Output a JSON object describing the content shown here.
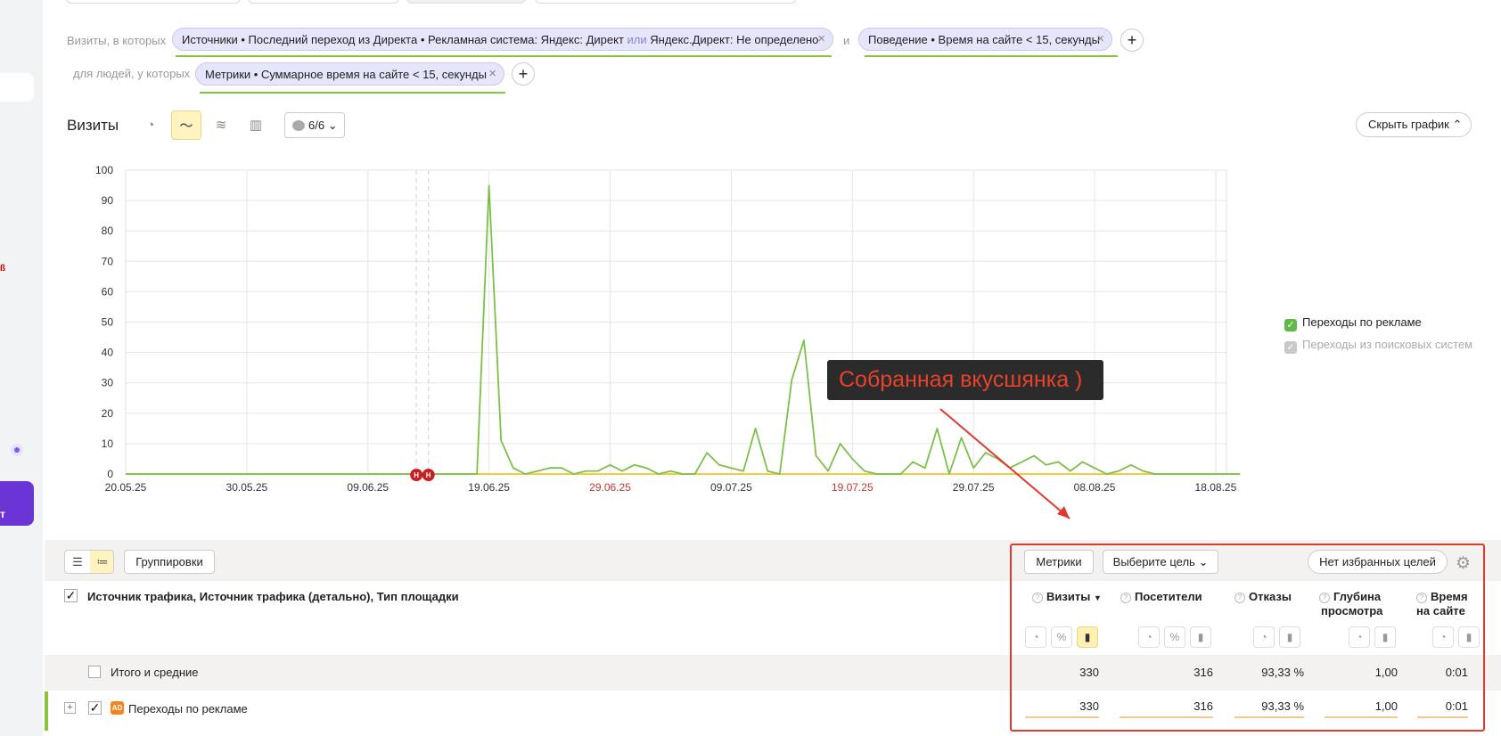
{
  "segment": {
    "visits_label": "Визиты, в которых",
    "chip1_text": "Источники • Последний переход из Директа • Рекламная система: Яндекс: Директ",
    "chip1_or": "или",
    "chip1_tail": "Яндекс.Директ: Не определено",
    "and_label": "и",
    "chip2_text": "Поведение • Время на сайте < 15, секунды",
    "people_label": "для людей, у которых",
    "chip3_text": "Метрики • Суммарное время на сайте < 15, секунды",
    "remove_glyph": "×",
    "add_glyph": "+"
  },
  "chart_header": {
    "title": "Визиты",
    "annotations_count": "6/6",
    "hide_chart_label": "Скрыть график"
  },
  "chart_data": {
    "type": "line",
    "ylim": [
      0,
      100
    ],
    "yticks": [
      "100",
      "90",
      "80",
      "70",
      "60",
      "50",
      "40",
      "30",
      "20",
      "10",
      "0"
    ],
    "x_start": "2025-05-20",
    "xticks": [
      {
        "label": "20.05.25",
        "weekend": false
      },
      {
        "label": "30.05.25",
        "weekend": false
      },
      {
        "label": "09.06.25",
        "weekend": false
      },
      {
        "label": "19.06.25",
        "weekend": false
      },
      {
        "label": "29.06.25",
        "weekend": true
      },
      {
        "label": "09.07.25",
        "weekend": false
      },
      {
        "label": "19.07.25",
        "weekend": true
      },
      {
        "label": "29.07.25",
        "weekend": false
      },
      {
        "label": "08.08.25",
        "weekend": false
      },
      {
        "label": "18.08.25",
        "weekend": false
      }
    ],
    "series": [
      {
        "name": "Переходы по рекламе",
        "color": "#7cc04b",
        "values": [
          0,
          0,
          0,
          0,
          0,
          0,
          0,
          0,
          0,
          0,
          0,
          0,
          0,
          0,
          0,
          0,
          0,
          0,
          0,
          0,
          0,
          0,
          0,
          0,
          0,
          0,
          0,
          0,
          0,
          0,
          95,
          11,
          2,
          0,
          1,
          2,
          2,
          0,
          1,
          1,
          3,
          1,
          3,
          2,
          0,
          1,
          0,
          0,
          7,
          3,
          2,
          1,
          15,
          1,
          0,
          31,
          44,
          6,
          1,
          10,
          5,
          1,
          0,
          0,
          0,
          4,
          2,
          15,
          0,
          12,
          2,
          7,
          5,
          2,
          4,
          6,
          3,
          4,
          1,
          4,
          2,
          0,
          1,
          3,
          1,
          0,
          0,
          0,
          0,
          0,
          0,
          0,
          0
        ]
      },
      {
        "name": "Переходы из поисковых систем",
        "color": "#f2cc3a",
        "values": [
          0,
          0,
          0,
          0,
          0,
          0,
          0,
          0,
          0,
          0,
          0,
          0,
          0,
          0,
          0,
          0,
          0,
          0,
          0,
          0,
          0,
          0,
          0,
          0,
          0,
          0,
          0,
          0,
          0,
          0,
          0,
          0,
          0,
          0,
          0,
          0,
          0,
          0,
          0,
          0,
          0,
          0,
          0,
          0,
          0,
          0,
          0,
          0,
          0,
          0,
          0,
          0,
          0,
          0,
          0,
          0,
          0,
          0,
          0,
          0,
          0,
          0,
          0,
          0,
          0,
          0,
          0,
          0,
          0,
          0,
          0,
          0,
          0,
          0,
          0,
          0,
          0,
          0,
          0,
          0,
          0,
          0,
          0,
          0,
          0,
          0,
          0,
          0,
          0,
          0,
          0,
          0,
          0
        ]
      }
    ],
    "markers": [
      {
        "label": "Н",
        "x": "2025-06-13"
      },
      {
        "label": "Н",
        "x": "2025-06-14"
      }
    ],
    "grid": true
  },
  "legend": [
    {
      "label": "Переходы по рекламе",
      "checked": true,
      "color": "#5fb84a"
    },
    {
      "label": "Переходы из поисковых систем",
      "checked": true,
      "color": "#c8c8c8"
    }
  ],
  "callout": "Собранная вкусшянка )",
  "toolbar": {
    "groupings_label": "Группировки",
    "metrics_label": "Метрики",
    "goal_label": "Выберите цель",
    "fav_goals_label": "Нет избранных целей"
  },
  "table": {
    "dimension_title": "Источник трафика, Источник трафика (детально), Тип площадки",
    "columns": [
      {
        "line1": "Визиты",
        "line2": "",
        "sort": "▼"
      },
      {
        "line1": "Посетители",
        "line2": ""
      },
      {
        "line1": "Отказы",
        "line2": ""
      },
      {
        "line1": "Глубина",
        "line2": "просмотра"
      },
      {
        "line1": "Время",
        "line2": "на сайте"
      }
    ],
    "totals_label": "Итого и средние",
    "totals": [
      "330",
      "316",
      "93,33 %",
      "1,00",
      "0:01"
    ],
    "rows": [
      {
        "badge": "AD",
        "label": "Переходы по рекламе",
        "values": [
          "330",
          "316",
          "93,33 %",
          "1,00",
          "0:01"
        ],
        "share": [
          1,
          1,
          1,
          1,
          1
        ]
      }
    ]
  }
}
